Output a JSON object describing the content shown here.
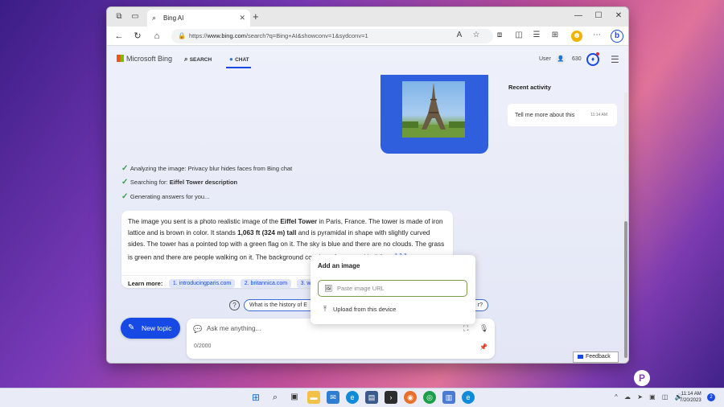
{
  "browser": {
    "tab_title": "Bing AI",
    "tab_close": "✕",
    "new_tab": "+",
    "url_prefix": "https://",
    "url_host": "www.bing.com",
    "url_rest": "/search?q=Bing+AI&showconv=1&sydconv=1"
  },
  "header": {
    "logo_text": "Microsoft Bing",
    "nav_search": "SEARCH",
    "nav_chat": "CHAT",
    "user_label": "User",
    "points": "630"
  },
  "status": [
    {
      "text": "Analyzing the image: Privacy blur hides faces from Bing chat"
    },
    {
      "text_pre": "Searching for: ",
      "text_bold": "Eiffel Tower description"
    },
    {
      "text": "Generating answers for you..."
    }
  ],
  "answer": {
    "p1": "The image you sent is a photo realistic image of the ",
    "b1": "Eiffel Tower",
    "p2": " in Paris, France. The tower is made of iron lattice and is brown in color. It stands ",
    "b2": "1,063 ft (324 m) tall",
    "p3": " and is pyramidal in shape with slightly curved sides. The tower has a pointed top with a green flag on it. The sky is blue and there are no clouds. The grass is green and there are people walking on it. The background consists of trees and buildings",
    "cites": [
      "1",
      "2",
      "3"
    ],
    "end": ".",
    "learn_more": "Learn more:",
    "sources": [
      "1. introducingparis.com",
      "2. britannica.com",
      "3. wo"
    ]
  },
  "suggestion": {
    "text": "What is the history of E",
    "tail": "r?"
  },
  "popup": {
    "title": "Add an image",
    "placeholder": "Paste image URL",
    "upload": "Upload from this device"
  },
  "composer": {
    "new_topic": "New topic",
    "placeholder": "Ask me anything...",
    "counter": "0/2000"
  },
  "sidebar": {
    "recent_title": "Recent activity",
    "recent_item": "Tell me more about this",
    "recent_time": "11:14 AM"
  },
  "feedback": "Feedback",
  "taskbar": {
    "time": "11:14 AM",
    "date": "7/20/2023",
    "notifications": "2"
  },
  "watermark": "P"
}
